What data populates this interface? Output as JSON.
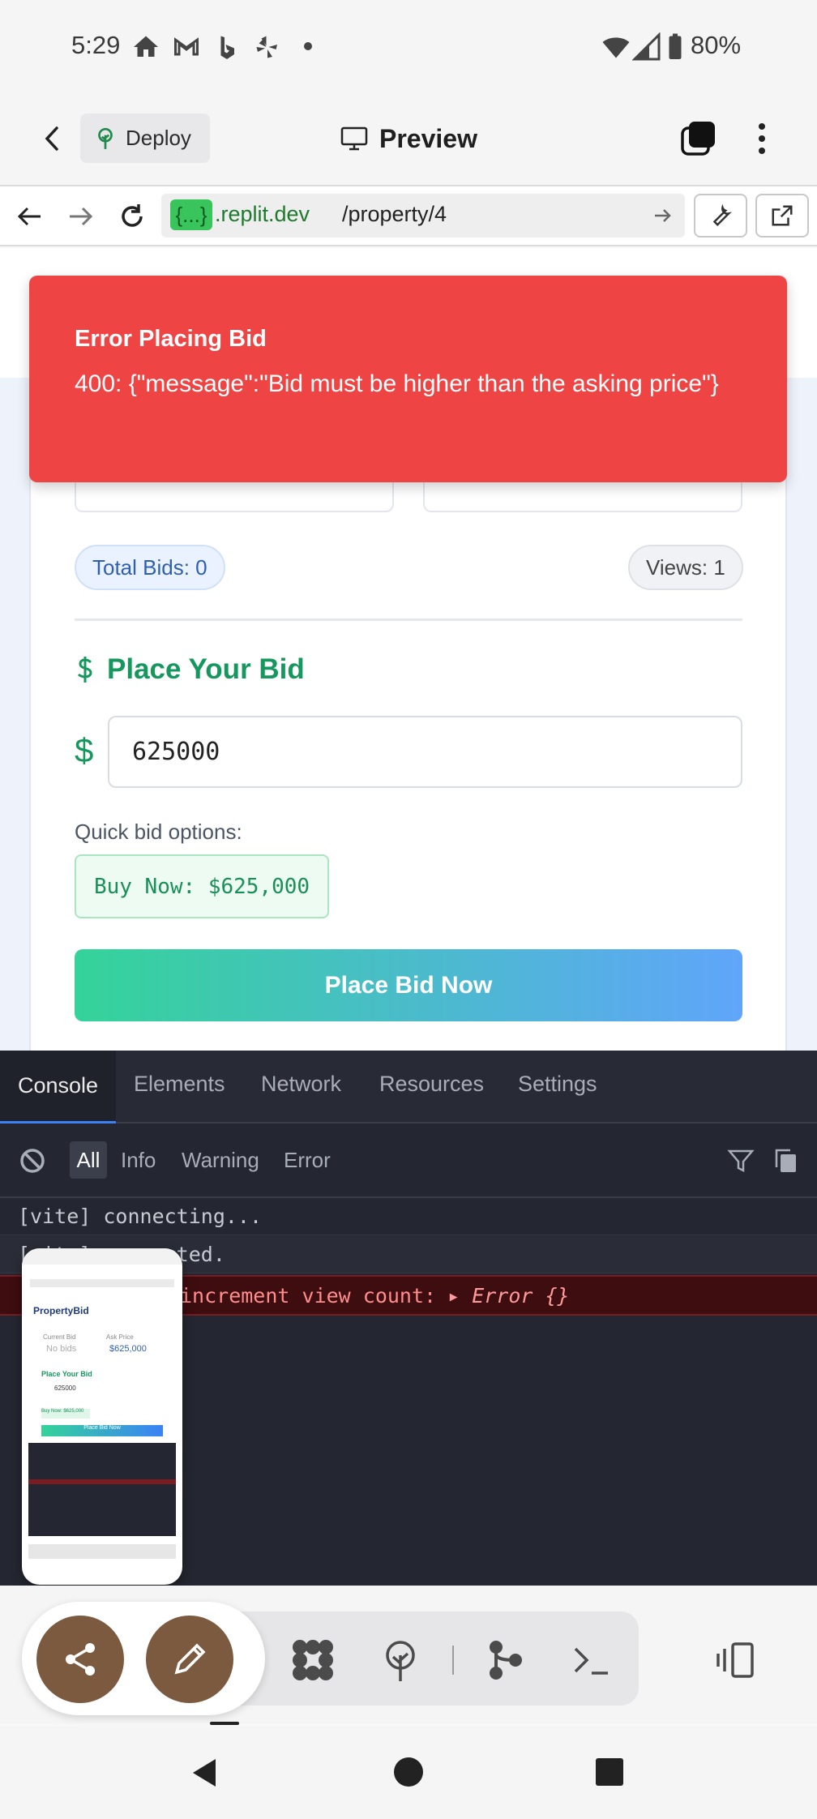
{
  "status_bar": {
    "time": "5:29",
    "battery": "80%",
    "icons": [
      "home-icon",
      "gmail-icon",
      "bing-icon",
      "yelp-icon",
      "dot-icon",
      "wifi-icon",
      "signal-icon",
      "battery-icon"
    ]
  },
  "app_header": {
    "deploy_label": "Deploy",
    "preview_label": "Preview"
  },
  "browser": {
    "host_tag": "{...}",
    "host": ".replit.dev",
    "path": "/property/4"
  },
  "toast": {
    "title": "Error Placing Bid",
    "message": "400: {\"message\":\"Bid must be higher than the asking price\"}",
    "color": "#ef4444"
  },
  "property": {
    "total_bids": "Total Bids: 0",
    "views": "Views: 1",
    "bid_title": "Place Your Bid",
    "currency_symbol": "$",
    "bid_value": "625000",
    "quick_label": "Quick bid options:",
    "buy_now": "Buy Now: $625,000",
    "place_bid": "Place Bid Now",
    "accent": "#16975e"
  },
  "devtools": {
    "tabs": [
      "Console",
      "Elements",
      "Network",
      "Resources",
      "Settings"
    ],
    "filters": [
      "All",
      "Info",
      "Warning",
      "Error"
    ],
    "logs": [
      {
        "text": "[vite] connecting...",
        "level": "log"
      },
      {
        "text": "[vite] connected.",
        "level": "log"
      },
      {
        "text": "increment view count:",
        "object": "Error {}",
        "level": "error"
      }
    ]
  },
  "thumbnail": {
    "brand": "PropertyBid",
    "label1": "Current Bid",
    "label2": "Ask Price",
    "value1": "No bids",
    "value2": "$625,000",
    "bid_title": "Place Your Bid",
    "input_value": "625000",
    "buy_now": "Buy Now: $625,000",
    "place_bid": "Place Bid Now"
  }
}
